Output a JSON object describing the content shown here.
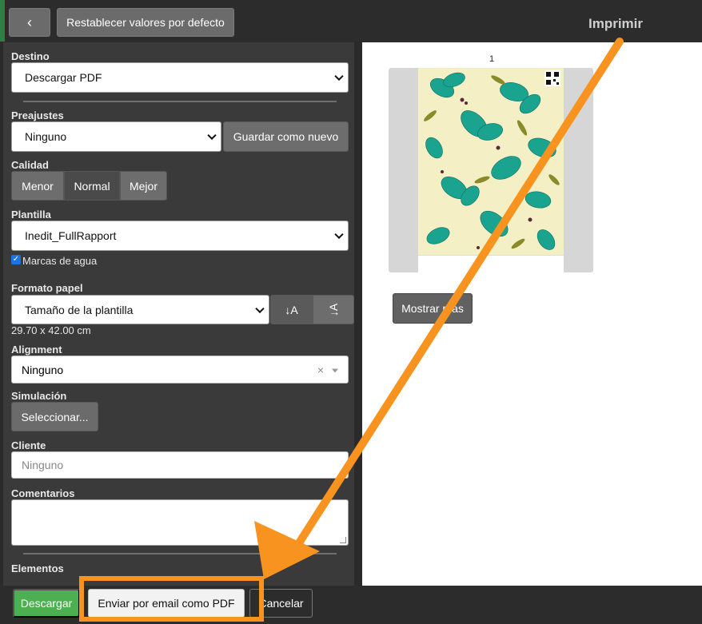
{
  "header": {
    "back_glyph": "‹",
    "reset_label": "Restablecer valores por defecto",
    "title": "Imprimir"
  },
  "form": {
    "destino": {
      "label": "Destino",
      "value": "Descargar PDF"
    },
    "preajustes": {
      "label": "Preajustes",
      "value": "Ninguno",
      "save_label": "Guardar como nuevo"
    },
    "calidad": {
      "label": "Calidad",
      "options": [
        "Menor",
        "Normal",
        "Mejor"
      ],
      "selected": "Normal"
    },
    "plantilla": {
      "label": "Plantilla",
      "value": "Inedit_FullRapport",
      "watermark_label": "Marcas de agua",
      "watermark_checked": true
    },
    "formato": {
      "label": "Formato papel",
      "value": "Tamaño de la plantilla",
      "portrait_glyph": "↓A",
      "landscape_glyph": "↓A",
      "size_text": "29.70 x 42.00 cm"
    },
    "alignment": {
      "label": "Alignment",
      "value": "Ninguno",
      "clear_glyph": "×"
    },
    "simulacion": {
      "label": "Simulación",
      "button_label": "Seleccionar..."
    },
    "cliente": {
      "label": "Cliente",
      "placeholder": "Ninguno"
    },
    "comentarios": {
      "label": "Comentarios",
      "value": ""
    },
    "elementos": {
      "label": "Elementos"
    }
  },
  "footer": {
    "download_label": "Descargar",
    "email_label": "Enviar por email como PDF",
    "cancel_label": "Cancelar"
  },
  "preview": {
    "page_number": "1",
    "more_label": "Mostrar más"
  },
  "colors": {
    "annotation": "#f7931e",
    "download": "#4caf50",
    "panel": "#3a3a3a",
    "flower": "#1aa38f"
  },
  "icons": [
    "chevron-left-icon",
    "checkbox-checked-icon",
    "portrait-orientation-icon",
    "landscape-orientation-icon",
    "clear-icon",
    "dropdown-caret-icon",
    "qr-code-icon"
  ]
}
